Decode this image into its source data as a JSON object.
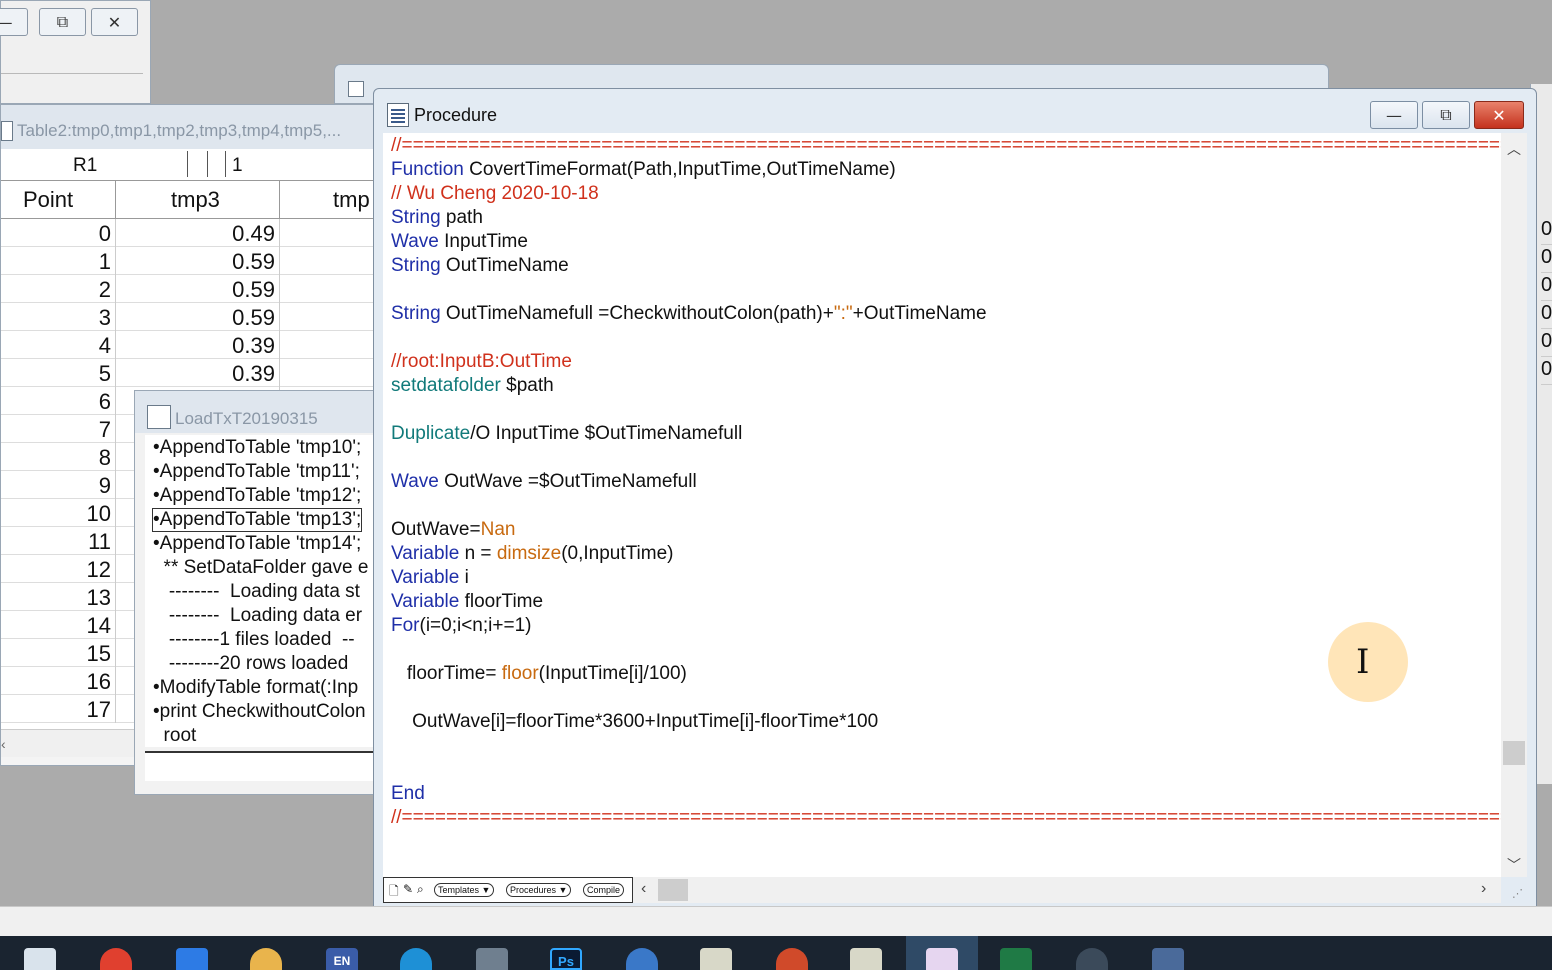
{
  "procedure_window": {
    "title": "Procedure",
    "controls": {
      "minimize": "—",
      "maximize": "⧉",
      "close": "✕"
    },
    "code_lines": [
      [
        {
          "t": "//==========================================================================================================================================",
          "c": "cm"
        }
      ],
      [
        {
          "t": "Function",
          "c": "kw"
        },
        {
          "t": " CovertTimeFormat(Path,InputTime,OutTimeName)",
          "c": ""
        }
      ],
      [
        {
          "t": "// Wu Cheng 2020-10-18",
          "c": "cm"
        }
      ],
      [
        {
          "t": "String",
          "c": "kw"
        },
        {
          "t": " path",
          "c": ""
        }
      ],
      [
        {
          "t": "Wave",
          "c": "kw"
        },
        {
          "t": " InputTime",
          "c": ""
        }
      ],
      [
        {
          "t": "String",
          "c": "kw"
        },
        {
          "t": " OutTimeName",
          "c": ""
        }
      ],
      [],
      [
        {
          "t": "String",
          "c": "kw"
        },
        {
          "t": " OutTimeNamefull =CheckwithoutColon(path)+",
          "c": ""
        },
        {
          "t": "\":\"",
          "c": "st"
        },
        {
          "t": "+OutTimeName",
          "c": ""
        }
      ],
      [],
      [
        {
          "t": "//root:InputB:OutTime",
          "c": "cm"
        }
      ],
      [
        {
          "t": "setdatafolder",
          "c": "op"
        },
        {
          "t": " $path",
          "c": ""
        }
      ],
      [],
      [
        {
          "t": "Duplicate",
          "c": "op"
        },
        {
          "t": "/O InputTime $OutTimeNamefull",
          "c": ""
        }
      ],
      [],
      [
        {
          "t": "Wave",
          "c": "kw"
        },
        {
          "t": " OutWave =$OutTimeNamefull",
          "c": ""
        }
      ],
      [],
      [
        {
          "t": "OutWave=",
          "c": ""
        },
        {
          "t": "Nan",
          "c": "fn"
        }
      ],
      [
        {
          "t": "Variable",
          "c": "kw"
        },
        {
          "t": " n = ",
          "c": ""
        },
        {
          "t": "dimsize",
          "c": "fn"
        },
        {
          "t": "(0,InputTime)",
          "c": ""
        }
      ],
      [
        {
          "t": "Variable",
          "c": "kw"
        },
        {
          "t": " i",
          "c": ""
        }
      ],
      [
        {
          "t": "Variable",
          "c": "kw"
        },
        {
          "t": " floorTime",
          "c": ""
        }
      ],
      [
        {
          "t": "For",
          "c": "kw"
        },
        {
          "t": "(i=0;i<n;i+=1)",
          "c": ""
        }
      ],
      [],
      [
        {
          "t": "   floorTime= ",
          "c": ""
        },
        {
          "t": "floor",
          "c": "fn"
        },
        {
          "t": "(InputTime[i]/100)",
          "c": ""
        }
      ],
      [],
      [
        {
          "t": "    OutWave[i]=floorTime*3600+InputTime[i]-floorTime*100",
          "c": ""
        }
      ],
      [],
      [],
      [
        {
          "t": "End",
          "c": "kw"
        }
      ],
      [
        {
          "t": "//==========================================================================================================================================",
          "c": "cm"
        }
      ]
    ],
    "toolbar": {
      "templates": "Templates ▼",
      "procedures": "Procedures ▼",
      "compile": "Compile"
    }
  },
  "table_window": {
    "title": "Table2:tmp0,tmp1,tmp2,tmp3,tmp4,tmp5,...",
    "entry_cell_name": "R1",
    "entry_value": "1",
    "columns": [
      "Point",
      "tmp3",
      "tmp"
    ],
    "rows": [
      {
        "point": "0",
        "tmp3": "0.49"
      },
      {
        "point": "1",
        "tmp3": "0.59"
      },
      {
        "point": "2",
        "tmp3": "0.59"
      },
      {
        "point": "3",
        "tmp3": "0.59"
      },
      {
        "point": "4",
        "tmp3": "0.39"
      },
      {
        "point": "5",
        "tmp3": "0.39"
      },
      {
        "point": "6",
        "tmp3": ""
      },
      {
        "point": "7",
        "tmp3": ""
      },
      {
        "point": "8",
        "tmp3": ""
      },
      {
        "point": "9",
        "tmp3": ""
      },
      {
        "point": "10",
        "tmp3": ""
      },
      {
        "point": "11",
        "tmp3": ""
      },
      {
        "point": "12",
        "tmp3": ""
      },
      {
        "point": "13",
        "tmp3": ""
      },
      {
        "point": "14",
        "tmp3": ""
      },
      {
        "point": "15",
        "tmp3": ""
      },
      {
        "point": "16",
        "tmp3": ""
      },
      {
        "point": "17",
        "tmp3": ""
      }
    ]
  },
  "load_window": {
    "title": "LoadTxT20190315",
    "history_lines": [
      "•AppendToTable 'tmp10';",
      "•AppendToTable 'tmp11';",
      "•AppendToTable 'tmp12';",
      "•AppendToTable 'tmp13';",
      "•AppendToTable 'tmp14';",
      "  ** SetDataFolder gave e",
      "   --------  Loading data st",
      "   --------  Loading data er",
      "   --------1 files loaded  --",
      "   --------20 rows loaded",
      "•ModifyTable format(:Inp",
      "•print CheckwithoutColon",
      "  root"
    ],
    "selected_line": 3
  },
  "taskbar": {
    "language_indicator": "EN",
    "photoshop_label": "Ps"
  },
  "colors": {
    "keyword": "#1f2fa8",
    "operation": "#117a7a",
    "builtin": "#c86a10",
    "comment": "#d0311c",
    "close_button": "#c4321d",
    "taskbar": "#1a2430"
  }
}
